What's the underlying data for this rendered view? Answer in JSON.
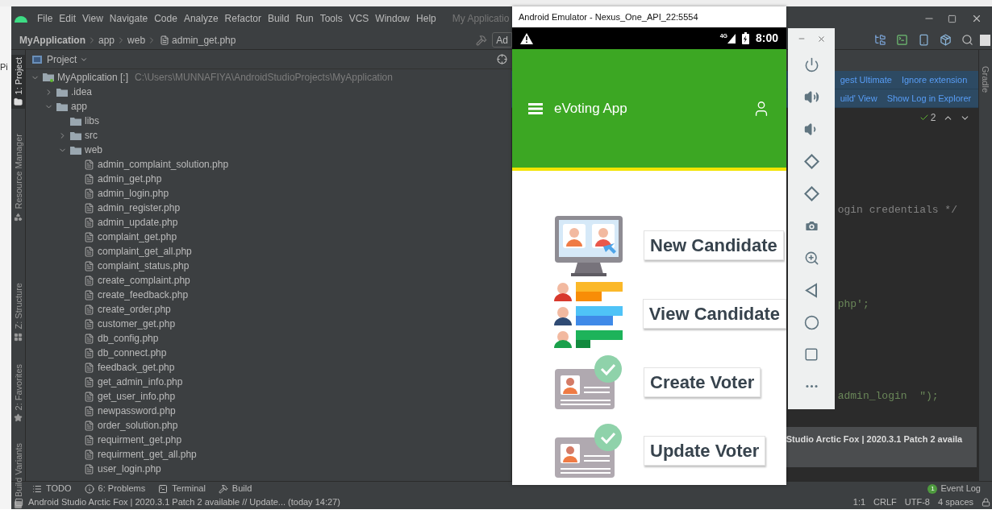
{
  "desktop": {
    "fragment": "Pi"
  },
  "ide": {
    "menu": [
      "File",
      "Edit",
      "View",
      "Navigate",
      "Code",
      "Analyze",
      "Refactor",
      "Build",
      "Run",
      "Tools",
      "VCS",
      "Window",
      "Help"
    ],
    "title_fragment": "My Applicatio",
    "breadcrumb": [
      "MyApplication",
      "app",
      "web",
      "admin_get.php"
    ],
    "toolbar_fragment": "Ad",
    "side_tabs": [
      {
        "label": "1: Project",
        "selected": true
      },
      {
        "label": "Resource Manager",
        "selected": false
      },
      {
        "label": "Z: Structure",
        "selected": false
      },
      {
        "label": "2: Favorites",
        "selected": false
      },
      {
        "label": "Build Variants",
        "selected": false
      }
    ],
    "project_panel": {
      "title": "Project",
      "tree": [
        {
          "label": "MyApplication [:]",
          "path": "C:\\Users\\MUNNAFIYA\\AndroidStudioProjects\\MyApplication",
          "kind": "module",
          "expanded": true,
          "children": [
            {
              "label": ".idea",
              "kind": "folder",
              "expanded": false
            },
            {
              "label": "app",
              "kind": "folder",
              "expanded": true,
              "children": [
                {
                  "label": "libs",
                  "kind": "folder"
                },
                {
                  "label": "src",
                  "kind": "folder",
                  "expanded": false
                },
                {
                  "label": "web",
                  "kind": "folder",
                  "expanded": true,
                  "children": [
                    {
                      "label": "admin_complaint_solution.php",
                      "kind": "file"
                    },
                    {
                      "label": "admin_get.php",
                      "kind": "file"
                    },
                    {
                      "label": "admin_login.php",
                      "kind": "file"
                    },
                    {
                      "label": "admin_register.php",
                      "kind": "file"
                    },
                    {
                      "label": "admin_update.php",
                      "kind": "file"
                    },
                    {
                      "label": "complaint_get.php",
                      "kind": "file"
                    },
                    {
                      "label": "complaint_get_all.php",
                      "kind": "file"
                    },
                    {
                      "label": "complaint_status.php",
                      "kind": "file"
                    },
                    {
                      "label": "create_complaint.php",
                      "kind": "file"
                    },
                    {
                      "label": "create_feedback.php",
                      "kind": "file"
                    },
                    {
                      "label": "create_order.php",
                      "kind": "file"
                    },
                    {
                      "label": "customer_get.php",
                      "kind": "file"
                    },
                    {
                      "label": "db_config.php",
                      "kind": "file"
                    },
                    {
                      "label": "db_connect.php",
                      "kind": "file"
                    },
                    {
                      "label": "feedback_get.php",
                      "kind": "file"
                    },
                    {
                      "label": "get_admin_info.php",
                      "kind": "file"
                    },
                    {
                      "label": "get_user_info.php",
                      "kind": "file"
                    },
                    {
                      "label": "newpassword.php",
                      "kind": "file"
                    },
                    {
                      "label": "order_solution.php",
                      "kind": "file"
                    },
                    {
                      "label": "requirment_get.php",
                      "kind": "file"
                    },
                    {
                      "label": "requirment_get_all.php",
                      "kind": "file"
                    },
                    {
                      "label": "user_login.php",
                      "kind": "file"
                    }
                  ]
                }
              ]
            }
          ]
        }
      ]
    },
    "notifications": [
      {
        "left": "gest Ultimate",
        "right": "Ignore extension"
      },
      {
        "left": "uild' View",
        "right": "Show Log in Explorer"
      }
    ],
    "inspection_count": "2",
    "code_lines": [
      {
        "text": "ogin credentials */",
        "kind": "comment"
      },
      {
        "text": "php';",
        "kind": "string"
      },
      {
        "text": "admin_login  \");",
        "kind": "string"
      }
    ],
    "right_tab": "Gradle",
    "balloon": "Studio Arctic Fox | 2020.3.1 Patch 2 availa",
    "bottom_tabs": [
      {
        "label": "TODO",
        "kind": "todo"
      },
      {
        "label": "6: Problems",
        "kind": "problems"
      },
      {
        "label": "Terminal",
        "kind": "terminal"
      },
      {
        "label": "Build",
        "kind": "build"
      }
    ],
    "event_log": {
      "label": "Event Log",
      "count": "1"
    },
    "status_message": "Android Studio Arctic Fox | 2020.3.1 Patch 2 available // Update... (today 14:27)",
    "status_items": [
      "1:1",
      "CRLF",
      "UTF-8",
      "4 spaces"
    ]
  },
  "emulator": {
    "title": "Android Emulator - Nexus_One_API_22:5554",
    "network": "4G",
    "time": "8:00",
    "app_title": "eVoting App",
    "actions": [
      {
        "label": "New Candidate",
        "kind": "monitor"
      },
      {
        "label": "View Candidate",
        "kind": "list"
      },
      {
        "label": "Create Voter",
        "kind": "card"
      },
      {
        "label": "Update Voter",
        "kind": "card"
      }
    ]
  }
}
